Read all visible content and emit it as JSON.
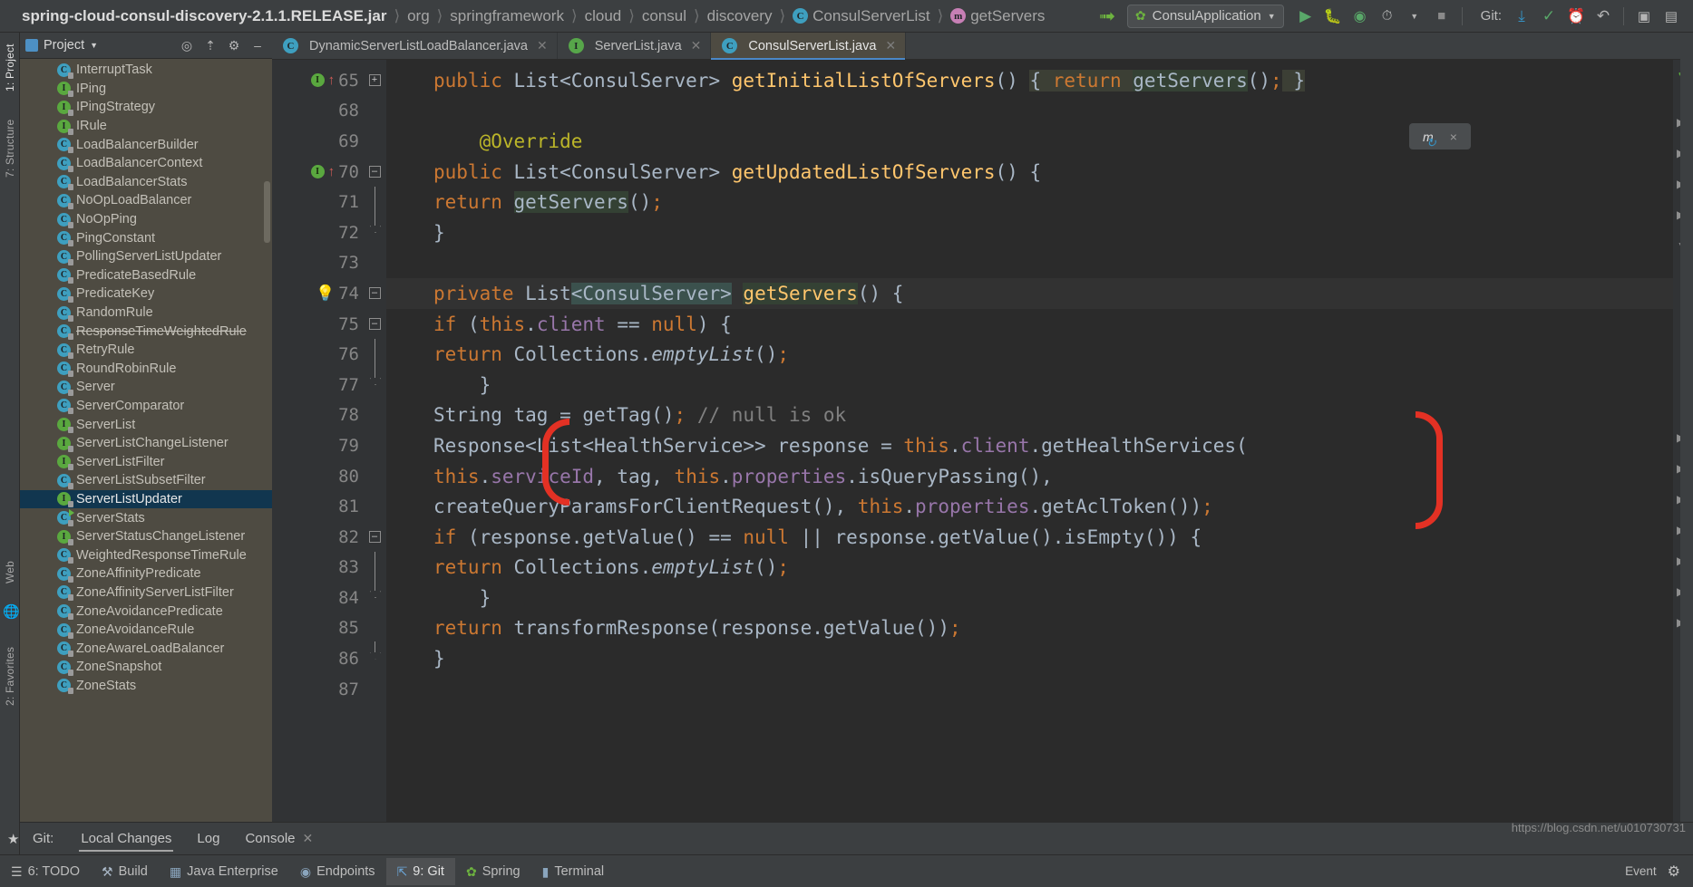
{
  "breadcrumb": {
    "root": "spring-cloud-consul-discovery-2.1.1.RELEASE.jar",
    "items": [
      {
        "label": "org",
        "icon": ""
      },
      {
        "label": "springframework",
        "icon": ""
      },
      {
        "label": "cloud",
        "icon": ""
      },
      {
        "label": "consul",
        "icon": ""
      },
      {
        "label": "discovery",
        "icon": ""
      },
      {
        "label": "ConsulServerList",
        "icon": "class-icon"
      },
      {
        "label": "getServers",
        "icon": "method-icon"
      }
    ]
  },
  "toolbar": {
    "run_config": "ConsulApplication",
    "git_label": "Git:",
    "buttons": {
      "back": "back-arrow-icon",
      "run": "run-icon",
      "debug": "debug-icon",
      "run_coverage": "coverage-icon",
      "profile": "profile-icon",
      "stop": "stop-icon",
      "update_project": "update-project-icon",
      "commit": "commit-icon",
      "history": "history-icon",
      "rollback": "rollback-icon",
      "project_structure": "project-structure-icon",
      "settings": "settings-icon"
    }
  },
  "project_panel": {
    "title": "Project",
    "header_buttons": [
      "locate-icon",
      "collapse-all-icon",
      "settings-icon",
      "hide-icon"
    ],
    "tree": [
      {
        "label": "InterruptTask",
        "kind": "class",
        "deprecated": false,
        "selected": false
      },
      {
        "label": "IPing",
        "kind": "interface",
        "deprecated": false,
        "selected": false
      },
      {
        "label": "IPingStrategy",
        "kind": "interface",
        "deprecated": false,
        "selected": false
      },
      {
        "label": "IRule",
        "kind": "interface",
        "deprecated": false,
        "selected": false
      },
      {
        "label": "LoadBalancerBuilder",
        "kind": "class",
        "deprecated": false,
        "selected": false
      },
      {
        "label": "LoadBalancerContext",
        "kind": "class",
        "deprecated": false,
        "selected": false
      },
      {
        "label": "LoadBalancerStats",
        "kind": "class",
        "deprecated": false,
        "selected": false
      },
      {
        "label": "NoOpLoadBalancer",
        "kind": "class",
        "deprecated": false,
        "selected": false
      },
      {
        "label": "NoOpPing",
        "kind": "class",
        "deprecated": false,
        "selected": false
      },
      {
        "label": "PingConstant",
        "kind": "class",
        "deprecated": false,
        "selected": false
      },
      {
        "label": "PollingServerListUpdater",
        "kind": "class",
        "deprecated": false,
        "selected": false
      },
      {
        "label": "PredicateBasedRule",
        "kind": "class",
        "deprecated": false,
        "selected": false
      },
      {
        "label": "PredicateKey",
        "kind": "class",
        "deprecated": false,
        "selected": false
      },
      {
        "label": "RandomRule",
        "kind": "class",
        "deprecated": false,
        "selected": false
      },
      {
        "label": "ResponseTimeWeightedRule",
        "kind": "class",
        "deprecated": true,
        "selected": false
      },
      {
        "label": "RetryRule",
        "kind": "class",
        "deprecated": false,
        "selected": false
      },
      {
        "label": "RoundRobinRule",
        "kind": "class",
        "deprecated": false,
        "selected": false
      },
      {
        "label": "Server",
        "kind": "class",
        "deprecated": false,
        "selected": false
      },
      {
        "label": "ServerComparator",
        "kind": "class",
        "deprecated": false,
        "selected": false
      },
      {
        "label": "ServerList",
        "kind": "interface",
        "deprecated": false,
        "selected": false
      },
      {
        "label": "ServerListChangeListener",
        "kind": "interface",
        "deprecated": false,
        "selected": false
      },
      {
        "label": "ServerListFilter",
        "kind": "interface",
        "deprecated": false,
        "selected": false
      },
      {
        "label": "ServerListSubsetFilter",
        "kind": "class",
        "deprecated": false,
        "selected": false
      },
      {
        "label": "ServerListUpdater",
        "kind": "interface",
        "deprecated": false,
        "selected": true
      },
      {
        "label": "ServerStats",
        "kind": "class-runnable",
        "deprecated": false,
        "selected": false
      },
      {
        "label": "ServerStatusChangeListener",
        "kind": "interface",
        "deprecated": false,
        "selected": false
      },
      {
        "label": "WeightedResponseTimeRule",
        "kind": "class",
        "deprecated": false,
        "selected": false
      },
      {
        "label": "ZoneAffinityPredicate",
        "kind": "class",
        "deprecated": false,
        "selected": false
      },
      {
        "label": "ZoneAffinityServerListFilter",
        "kind": "class",
        "deprecated": false,
        "selected": false
      },
      {
        "label": "ZoneAvoidancePredicate",
        "kind": "class",
        "deprecated": false,
        "selected": false
      },
      {
        "label": "ZoneAvoidanceRule",
        "kind": "class",
        "deprecated": false,
        "selected": false
      },
      {
        "label": "ZoneAwareLoadBalancer",
        "kind": "class",
        "deprecated": false,
        "selected": false
      },
      {
        "label": "ZoneSnapshot",
        "kind": "class",
        "deprecated": false,
        "selected": false
      },
      {
        "label": "ZoneStats",
        "kind": "class",
        "deprecated": false,
        "selected": false
      }
    ]
  },
  "left_tool_strip": [
    {
      "label": "1: Project",
      "active": true
    },
    {
      "label": "7: Structure",
      "active": false
    },
    {
      "label": "Web",
      "active": false
    },
    {
      "label": "2: Favorites",
      "active": false
    }
  ],
  "editor_tabs": [
    {
      "label": "DynamicServerListLoadBalancer.java",
      "icon": "class-icon",
      "active": false,
      "closeable": true
    },
    {
      "label": "ServerList.java",
      "icon": "interface-icon",
      "active": false,
      "closeable": true
    },
    {
      "label": "ConsulServerList.java",
      "icon": "class-icon",
      "active": true,
      "closeable": true
    }
  ],
  "code": {
    "line_numbers": [
      "65",
      "68",
      "69",
      "70",
      "71",
      "72",
      "73",
      "74",
      "75",
      "76",
      "77",
      "78",
      "79",
      "80",
      "81",
      "82",
      "83",
      "84",
      "85",
      "86",
      "87"
    ],
    "lines": [
      "public List<ConsulServer> getInitialListOfServers() { return getServers(); }",
      "",
      "    @Override",
      "    public List<ConsulServer> getUpdatedListOfServers() {",
      "        return getServers();",
      "    }",
      "",
      "    private List<ConsulServer> getServers() {",
      "        if (this.client == null) {",
      "            return Collections.emptyList();",
      "        }",
      "        String tag = getTag(); // null is ok",
      "        Response<List<HealthService>> response = this.client.getHealthServices(",
      "                this.serviceId, tag, this.properties.isQueryPassing(),",
      "                createQueryParamsForClientRequest(), this.properties.getAclToken());",
      "        if (response.getValue() == null || response.getValue().isEmpty()) {",
      "            return Collections.emptyList();",
      "        }",
      "        return transformResponse(response.getValue());",
      "    }",
      ""
    ],
    "caret_line": "74",
    "comment_text": "// null is ok",
    "gutter_markers": {
      "implements_65": "I",
      "implements_70": "I",
      "bulb_74": "intention-bulb-icon"
    },
    "float_widget": {
      "label": "m",
      "close": "×"
    },
    "inspection_status": "ok-checkmark"
  },
  "git_window": {
    "label": "Git:",
    "tabs": [
      {
        "label": "Local Changes",
        "active": true,
        "closeable": false
      },
      {
        "label": "Log",
        "active": false,
        "closeable": false
      },
      {
        "label": "Console",
        "active": false,
        "closeable": true
      }
    ]
  },
  "watermark": "https://blog.csdn.net/u010730731",
  "status_bar": {
    "items": [
      {
        "label": "6: TODO",
        "icon": "todo-icon",
        "active": false
      },
      {
        "label": "Build",
        "icon": "build-icon",
        "active": false
      },
      {
        "label": "Java Enterprise",
        "icon": "java-ee-icon",
        "active": false
      },
      {
        "label": "Endpoints",
        "icon": "endpoints-icon",
        "active": false
      },
      {
        "label": "9: Git",
        "icon": "git-branch-icon",
        "active": true
      },
      {
        "label": "Spring",
        "icon": "spring-leaf-icon",
        "active": false
      },
      {
        "label": "Terminal",
        "icon": "terminal-icon",
        "active": false
      }
    ],
    "right": {
      "event_log": "Event",
      "settings": "gear-icon"
    }
  },
  "colors": {
    "accent_blue": "#4a88c7",
    "selection": "#11364f",
    "panel_bg": "#4e4b42",
    "editor_bg": "#2b2b2b",
    "chrome_bg": "#3c3f41",
    "annotation_red": "#e33124",
    "keyword": "#cc7832",
    "method": "#ffc66d",
    "field": "#9876aa",
    "comment": "#808080",
    "annotation_yellow": "#bbb529"
  }
}
